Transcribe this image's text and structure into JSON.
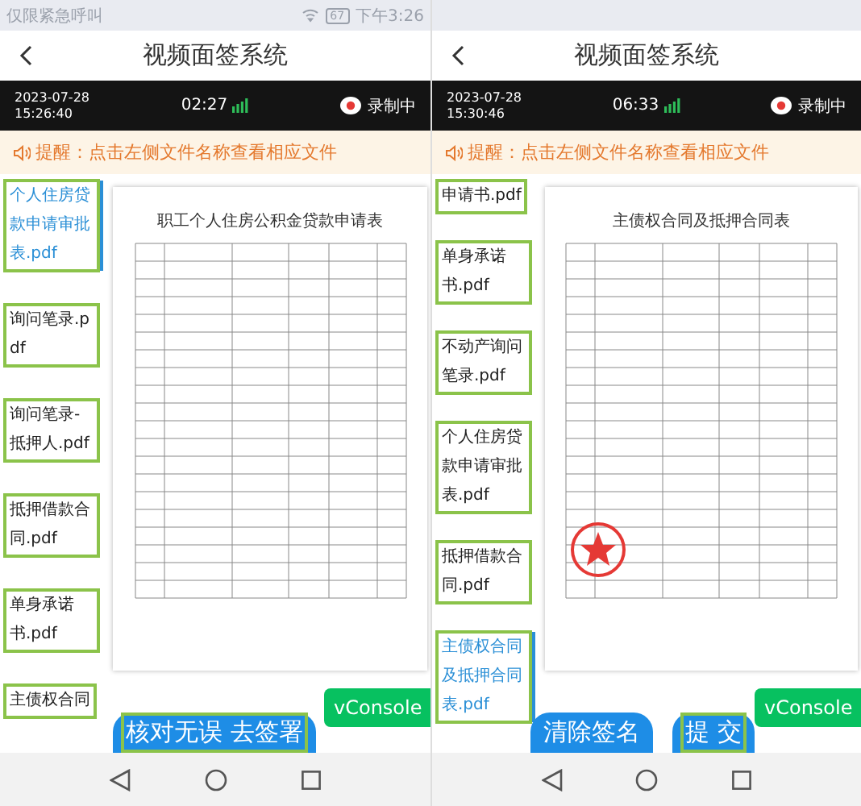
{
  "screens": [
    {
      "status_bar": {
        "carrier": "仅限紧急呼叫",
        "battery": "67",
        "time": "下午3:26"
      },
      "title": "视频面签系统",
      "video_bar": {
        "date": "2023-07-28",
        "clock": "15:26:40",
        "timer": "02:27",
        "recording": "录制中"
      },
      "notice": "提醒：点击左侧文件名称查看相应文件",
      "files": [
        {
          "name": "个人住房贷款申请审批表.pdf",
          "selected": true
        },
        {
          "name": "询问笔录.pdf",
          "selected": false
        },
        {
          "name": "询问笔录-抵押人.pdf",
          "selected": false
        },
        {
          "name": "抵押借款合同.pdf",
          "selected": false
        },
        {
          "name": "单身承诺书.pdf",
          "selected": false
        },
        {
          "name": "主债权合同",
          "selected": false
        }
      ],
      "document": {
        "title": "职工个人住房公积金贷款申请表",
        "stamp": false
      },
      "buttons": [
        {
          "label": "核对无误 去签署",
          "outlined": true
        }
      ],
      "console": "vConsole"
    },
    {
      "title": "视频面签系统",
      "video_bar": {
        "date": "2023-07-28",
        "clock": "15:30:46",
        "timer": "06:33",
        "recording": "录制中"
      },
      "notice": "提醒：点击左侧文件名称查看相应文件",
      "files": [
        {
          "name": "申请书.pdf",
          "selected": false
        },
        {
          "name": "单身承诺书.pdf",
          "selected": false
        },
        {
          "name": "不动产询问笔录.pdf",
          "selected": false
        },
        {
          "name": "个人住房贷款申请审批表.pdf",
          "selected": false
        },
        {
          "name": "抵押借款合同.pdf",
          "selected": false
        },
        {
          "name": "主债权合同及抵押合同表.pdf",
          "selected": true
        }
      ],
      "document": {
        "title": "主债权合同及抵押合同表",
        "stamp": true
      },
      "buttons": [
        {
          "label": "清除签名",
          "outlined": false
        },
        {
          "label": "提 交",
          "outlined": true
        }
      ],
      "console": "vConsole"
    }
  ]
}
